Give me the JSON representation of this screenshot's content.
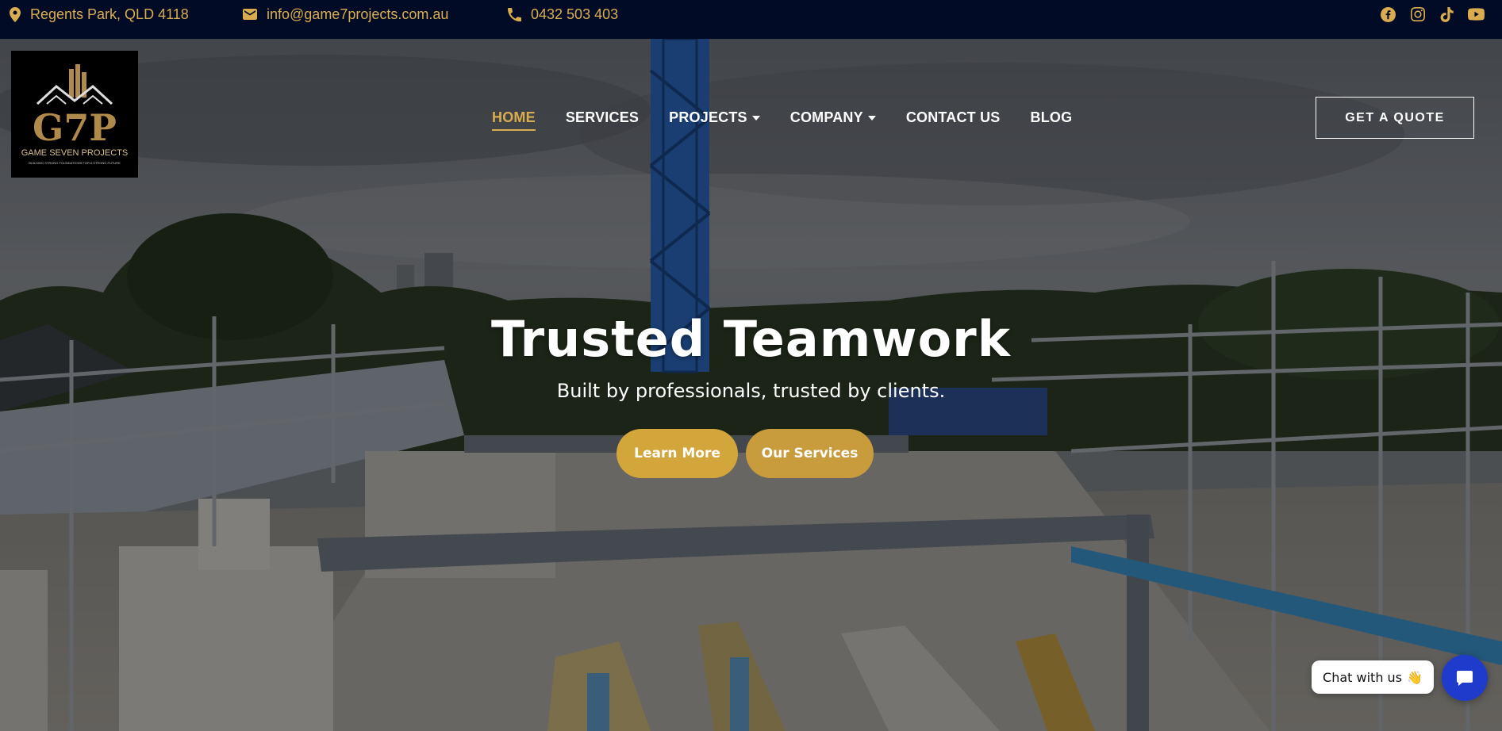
{
  "topbar": {
    "location": "Regents Park, QLD 4118",
    "email": "info@game7projects.com.au",
    "phone": "0432 503 403",
    "socials": [
      "facebook-icon",
      "instagram-icon",
      "tiktok-icon",
      "youtube-icon"
    ]
  },
  "logo": {
    "monogram": "G7P",
    "name": "GAME SEVEN PROJECTS",
    "tagline": "BUILDING STRONG FOUNDATIONS FOR A STRONG FUTURE"
  },
  "nav": {
    "items": [
      {
        "label": "HOME"
      },
      {
        "label": "SERVICES"
      },
      {
        "label": "PROJECTS"
      },
      {
        "label": "COMPANY"
      },
      {
        "label": "CONTACT US"
      },
      {
        "label": "BLOG"
      }
    ],
    "cta": "GET A QUOTE"
  },
  "hero": {
    "title": "Trusted Teamwork",
    "subtitle": "Built by professionals, trusted by clients.",
    "primary_button": "Learn More",
    "secondary_button": "Our Services"
  },
  "chat": {
    "label": "Chat with us",
    "emoji": "👋"
  },
  "colors": {
    "topbar_bg": "#020b26",
    "accent_gold": "#d9ad4f",
    "button_gold": "#d2a63b",
    "chat_blue": "#1f3bcc"
  }
}
